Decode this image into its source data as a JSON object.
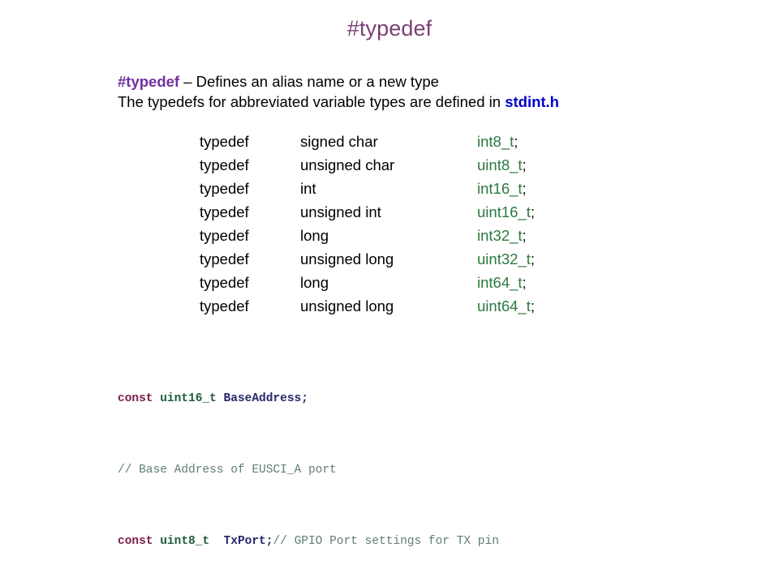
{
  "slide": {
    "title": "#typedef"
  },
  "intro": {
    "line1_keyword": "#typedef",
    "line1_rest": " – Defines an alias name or a new type",
    "line2_prefix": "The typedefs for abbreviated variable types are defined in ",
    "line2_header": "stdint.h"
  },
  "typedef_table": {
    "rows": [
      {
        "keyword": "typedef",
        "ctype": "signed char",
        "alias": "int8_t",
        "semicolon": ";",
        "far_tab": true
      },
      {
        "keyword": "typedef",
        "ctype": "unsigned char",
        "alias": "uint8_t",
        "semicolon": ";",
        "far_tab": true
      },
      {
        "keyword": "typedef",
        "ctype": "int",
        "alias": "int16_t",
        "semicolon": ";",
        "far_tab": true
      },
      {
        "keyword": "typedef",
        "ctype": "unsigned int",
        "alias": "uint16_t",
        "semicolon": ";",
        "far_tab": true
      },
      {
        "keyword": "typedef",
        "ctype": "long",
        "alias": "int32_t",
        "semicolon": ";",
        "far_tab": true
      },
      {
        "keyword": "typedef",
        "ctype": "unsigned long",
        "alias": "uint32_t",
        "semicolon": ";",
        "far_tab": true
      },
      {
        "keyword": "typedef",
        "ctype": "long",
        "alias": "int64_t",
        "semicolon": ";",
        "far_tab": false
      },
      {
        "keyword": "typedef",
        "ctype": "unsigned long",
        "alias": "uint64_t",
        "semicolon": ";",
        "far_tab": false
      }
    ]
  },
  "code": {
    "line1": {
      "kw": "const",
      "type": " uint16_t",
      "ident": " BaseAddress",
      "punct": ";"
    },
    "line2": {
      "comment": "// Base Address of EUSCI_A port"
    },
    "line3": {
      "kw": "const",
      "type": " uint8_t",
      "ident": "  TxPort",
      "punct": ";",
      "comment": "// GPIO Port settings for TX pin"
    }
  },
  "colors": {
    "title_plum": "#7B4173",
    "keyword_purple": "#7030A0",
    "header_blue": "#0000CC",
    "alias_green": "#2C7A3F",
    "code_const": "#7A1F4D",
    "code_type": "#1F5C3D",
    "code_ident": "#25296B",
    "code_comment": "#5F7F73",
    "body_black": "#000000",
    "background": "#FFFFFF"
  }
}
